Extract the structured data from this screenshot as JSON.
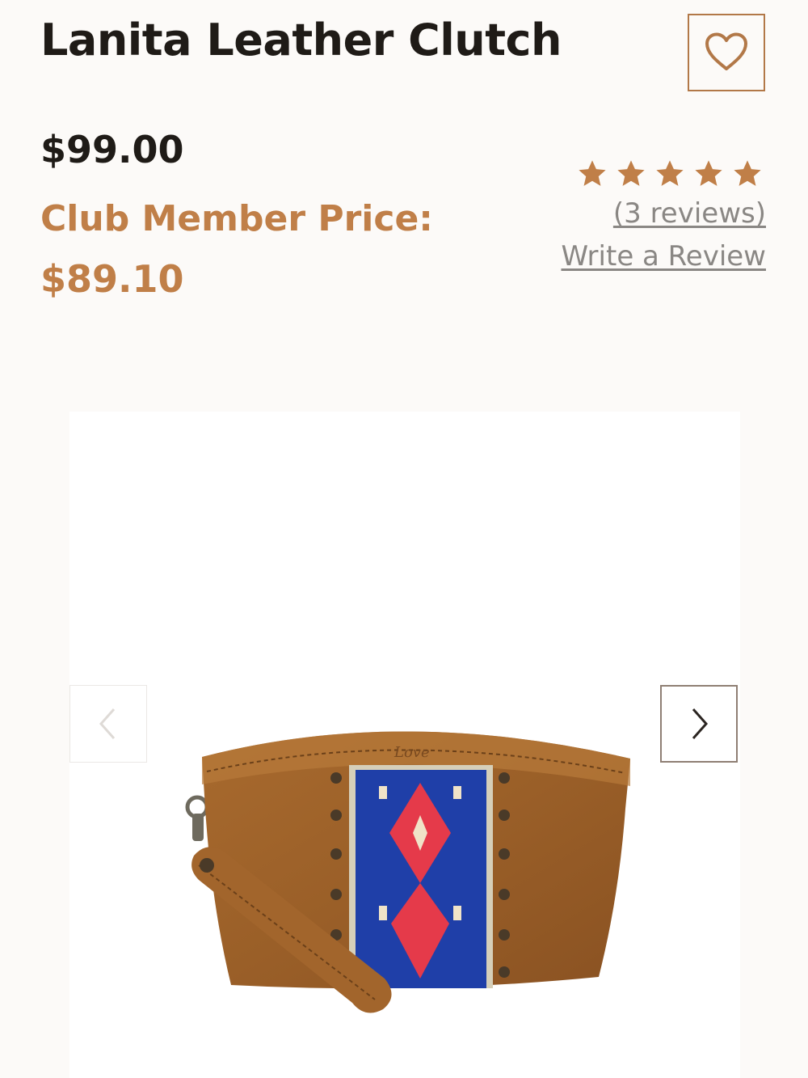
{
  "product": {
    "title": "Lanita Leather Clutch",
    "price": "$99.00",
    "club_label": "Club Member Price:",
    "club_price": "$89.10"
  },
  "rating": {
    "stars": 5,
    "max_stars": 5,
    "reviews_link": "(3 reviews)",
    "write_review": "Write a Review"
  },
  "icons": {
    "wishlist": "heart-icon",
    "prev": "chevron-left-icon",
    "next": "chevron-right-icon",
    "star": "star-icon"
  },
  "colors": {
    "accent": "#c07f48",
    "text": "#1f1b17",
    "muted_link": "#8a8784",
    "background": "#fcfaf8"
  }
}
